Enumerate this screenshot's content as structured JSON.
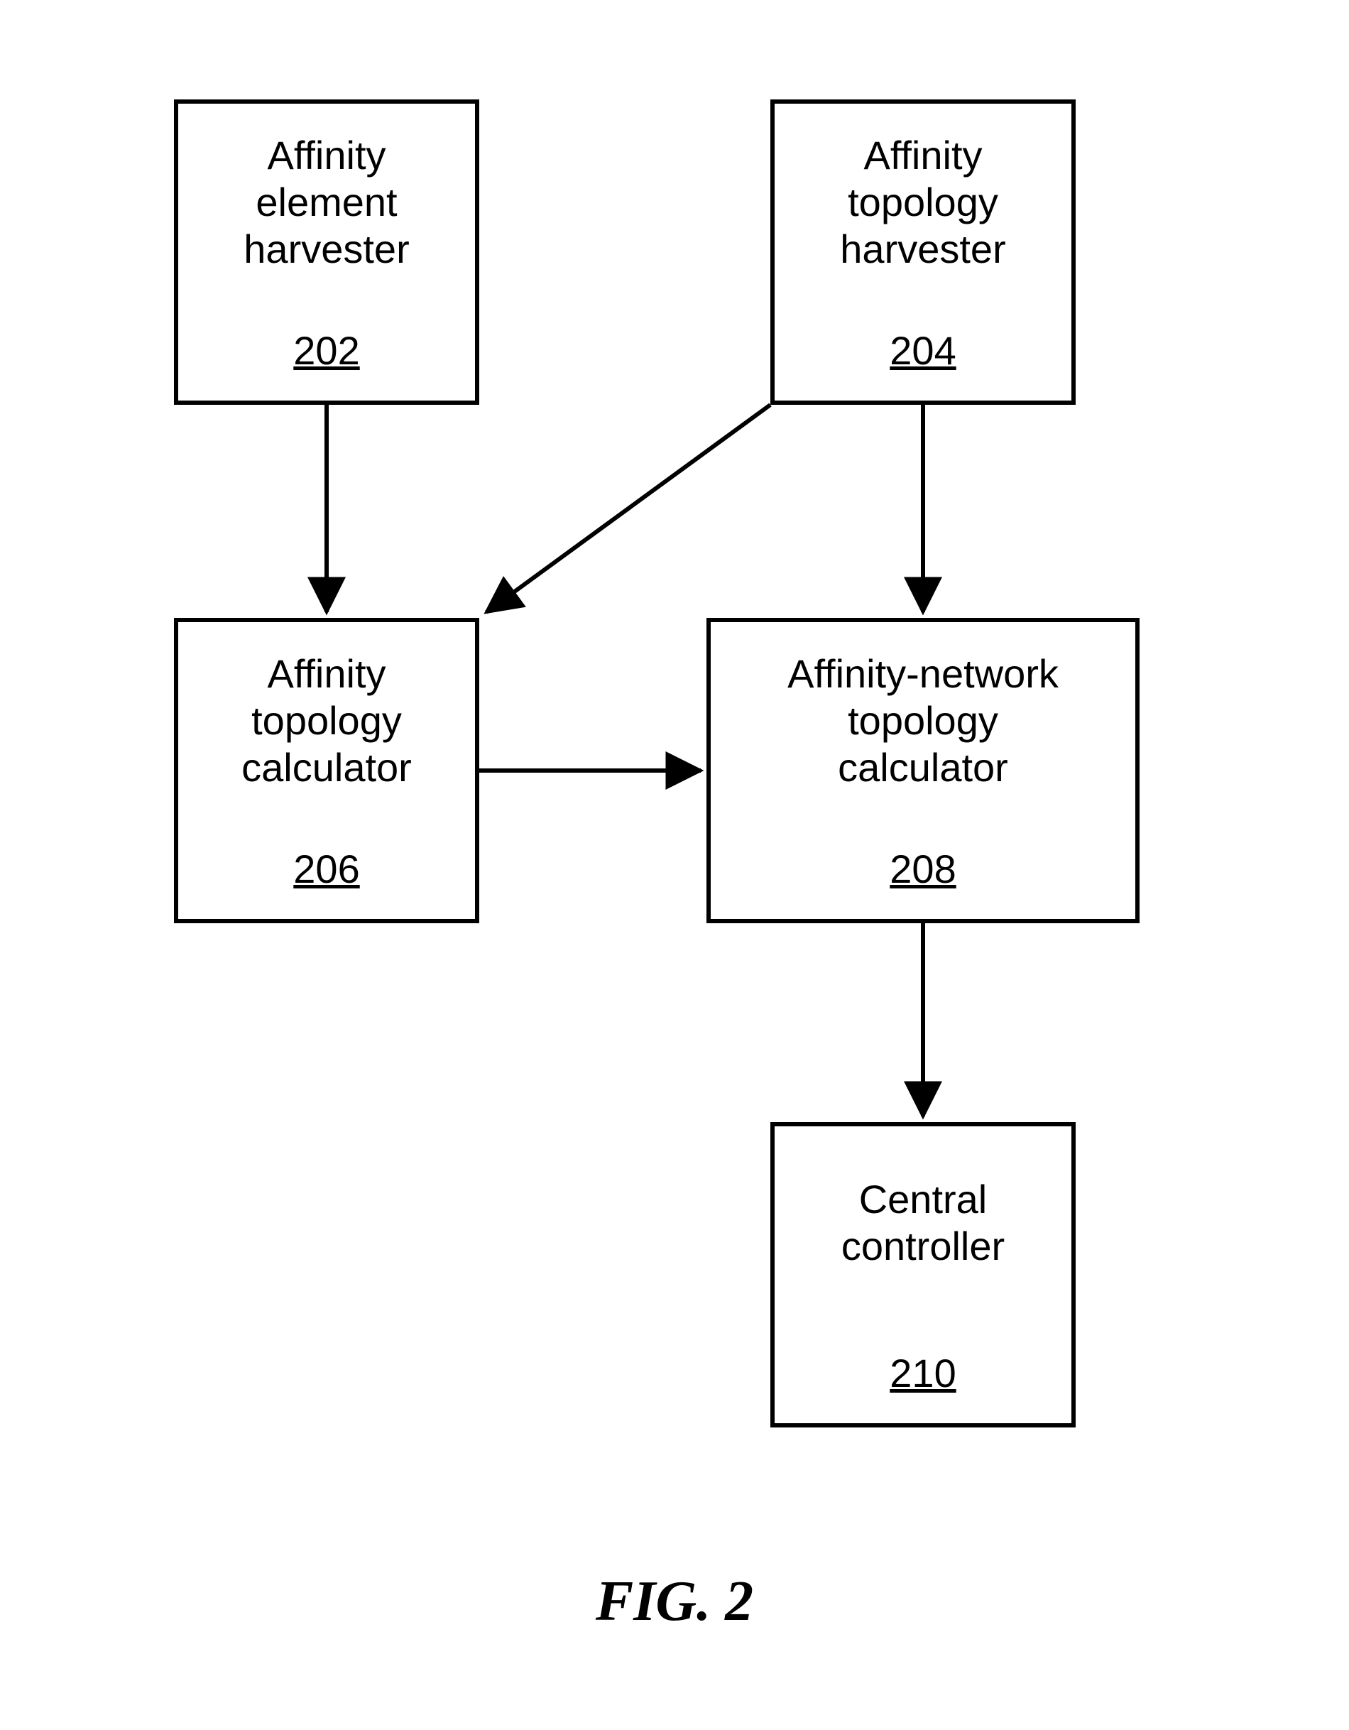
{
  "boxes": {
    "b202": {
      "title": "Affinity\nelement\nharvester",
      "num": "202"
    },
    "b204": {
      "title": "Affinity\ntopology\nharvester",
      "num": "204"
    },
    "b206": {
      "title": "Affinity\ntopology\ncalculator",
      "num": "206"
    },
    "b208": {
      "title": "Affinity-network\ntopology\ncalculator",
      "num": "208"
    },
    "b210": {
      "title": "Central\ncontroller",
      "num": "210"
    }
  },
  "caption": "FIG. 2"
}
